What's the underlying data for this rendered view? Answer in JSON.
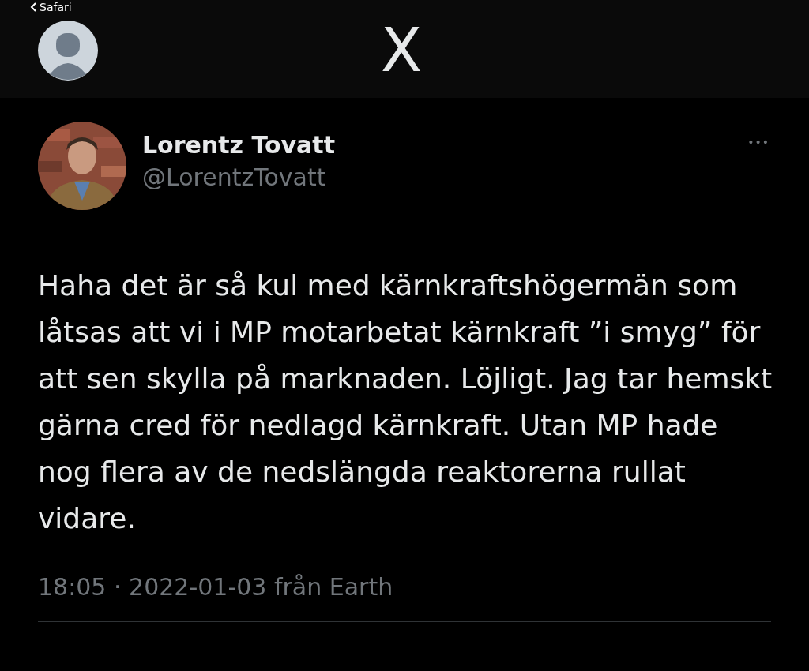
{
  "browser_back": {
    "label": "Safari"
  },
  "header": {
    "logo": "X"
  },
  "tweet": {
    "author": {
      "name": "Lorentz Tovatt",
      "handle": "@LorentzTovatt"
    },
    "more": "•••",
    "text": "Haha det är så kul med kärnkraftshögermän som låtsas att vi i MP motarbetat kärnkraft ”i smyg” för att sen skylla på marknaden. Löjligt. Jag tar hemskt gärna cred för nedlagd kärnkraft. Utan MP hade nog flera av de nedslängda reaktorerna rullat vidare.",
    "meta": "18:05 · 2022-01-03 från Earth"
  }
}
